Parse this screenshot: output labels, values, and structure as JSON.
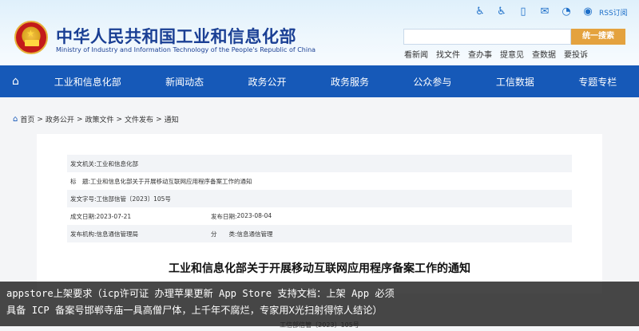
{
  "header": {
    "title_cn": "中华人民共和国工业和信息化部",
    "title_en": "Ministry of Industry and Information Technology of the People's Republic of China",
    "top_icons": [
      "accessibility-icon",
      "wheelchair-icon",
      "mobile-icon",
      "mail-icon",
      "wechat-icon",
      "weibo-icon"
    ],
    "rss_label": "RSS订阅",
    "search": {
      "placeholder": "",
      "button": "统一搜索"
    },
    "search_links": [
      "看新闻",
      "找文件",
      "查办事",
      "提意见",
      "查数据",
      "要投诉"
    ]
  },
  "nav": {
    "items": [
      "工业和信息化部",
      "新闻动态",
      "政务公开",
      "政务服务",
      "公众参与",
      "工信数据",
      "专题专栏"
    ]
  },
  "breadcrumb": [
    "首页",
    "政务公开",
    "政策文件",
    "文件发布",
    "通知"
  ],
  "meta": {
    "issuer_label": "发文机关:",
    "issuer": "工业和信息化部",
    "title_label": "标　题:",
    "title": "工业和信息化部关于开展移动互联网应用程序备案工作的通知",
    "doc_no_label": "发文字号:",
    "doc_no": "工信部信管〔2023〕105号",
    "written_label": "成文日期:",
    "written": "2023-07-21",
    "published_label": "发布日期:",
    "published": "2023-08-04",
    "org_label": "发布机构:",
    "org": "信息通信管理局",
    "category_label": "分　　类:",
    "category": "信息通信管理"
  },
  "document": {
    "title": "工业和信息化部关于开展移动互联网应用程序备案工作的通知",
    "number": "工信部信管〔2023〕105号"
  },
  "caption": {
    "line1": "appstore上架要求（icp许可证 办理苹果更新 App Store 支持文档：上架 App 必须",
    "line2": "具备 ICP 备案号邯郸寺庙一具高僧尸体，上千年不腐烂，专家用X光扫射得惊人结论）"
  }
}
